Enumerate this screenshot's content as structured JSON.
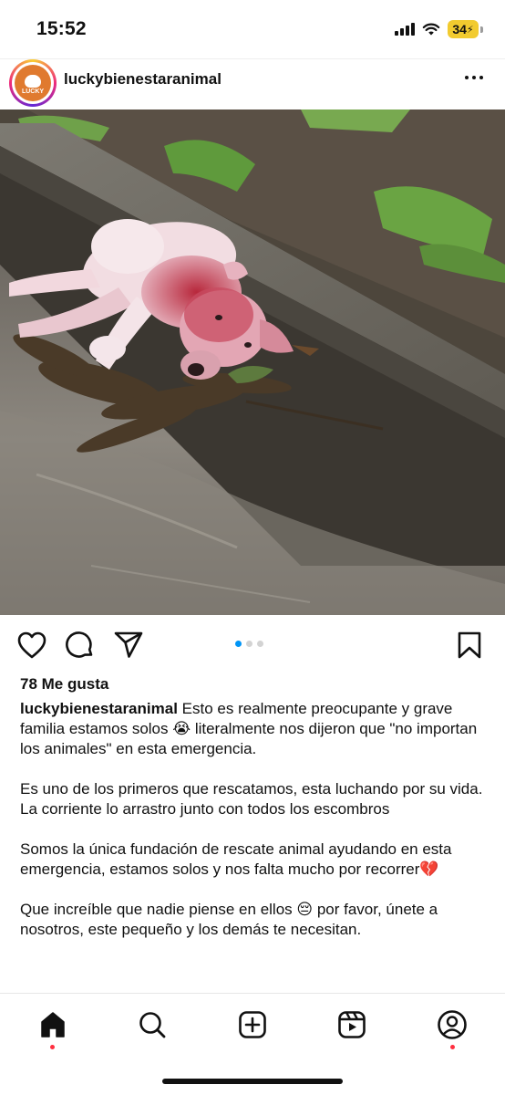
{
  "status_bar": {
    "time": "15:52",
    "battery": "34",
    "icons": [
      "signal-icon",
      "wifi-icon",
      "battery-charging-icon"
    ]
  },
  "post": {
    "username": "luckybienestaranimal",
    "avatar_label": "LUCKY",
    "carousel": {
      "current": 1,
      "total": 3
    },
    "likes": "78 Me gusta",
    "caption_user": "luckybienestaranimal",
    "caption_paragraphs": [
      "Esto es realmente preocupante y grave familia estamos solos 😭 literalmente nos dijeron que \"no importan los animales\" en esta emergencia.",
      "Es uno de los primeros que rescatamos, esta luchando por su vida. La corriente lo arrastro junto con todos los escombros",
      "Somos la única fundación de rescate animal ayudando en esta emergencia, estamos solos y nos falta mucho por recorrer💔",
      "Que increíble que nadie piense en ellos 😔 por favor, únete a nosotros, este pequeño y los demás te necesitan."
    ]
  },
  "actions": [
    "heart-icon",
    "comment-icon",
    "share-icon",
    "bookmark-icon"
  ],
  "tab_bar": [
    "home-icon",
    "search-icon",
    "create-icon",
    "reels-icon",
    "profile-icon"
  ],
  "colors": {
    "accent": "#0095f6",
    "notification": "#ff3040",
    "battery": "#f2cb2f"
  }
}
